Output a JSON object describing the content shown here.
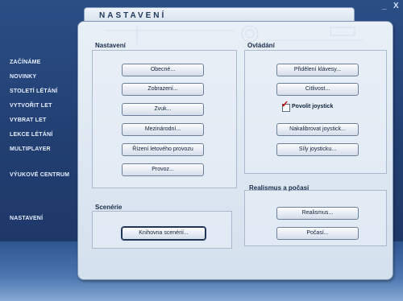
{
  "window": {
    "minimize": "_",
    "close": "X"
  },
  "header": {
    "title": "NASTAVENÍ"
  },
  "sidebar": {
    "items": [
      {
        "label": "ZAČÍNÁME"
      },
      {
        "label": "NOVINKY"
      },
      {
        "label": "STOLETÍ LÉTÁNÍ"
      },
      {
        "label": "VYTVOŘIT LET"
      },
      {
        "label": "VYBRAT LET"
      },
      {
        "label": "LEKCE LÉTÁNÍ"
      },
      {
        "label": "MULTIPLAYER"
      },
      {
        "label": "VÝUKOVÉ CENTRUM"
      },
      {
        "label": "NASTAVENÍ"
      }
    ]
  },
  "settings": {
    "title": "Nastavení",
    "buttons": [
      {
        "label": "Obecné..."
      },
      {
        "label": "Zobrazení..."
      },
      {
        "label": "Zvuk..."
      },
      {
        "label": "Mezinárodní..."
      },
      {
        "label": "Řízení letového provozu"
      },
      {
        "label": "Provoz..."
      }
    ]
  },
  "controls": {
    "title": "Ovládání",
    "assign_keys": "Přidělení klávesy...",
    "sensitivity": "Citlivost...",
    "enable_joystick": {
      "label": "Povolit joystick",
      "checked": true
    },
    "calibrate": "Nakalibrovat joystick...",
    "forces": "Síly joysticku..."
  },
  "realism": {
    "title": "Realismus a počasí",
    "realism_btn": "Realismus...",
    "weather_btn": "Počasí..."
  },
  "scenery": {
    "title": "Scenérie",
    "library_btn": "Knihovna scenérií..."
  },
  "colors": {
    "accent": "#223a5e",
    "check": "#c00000"
  }
}
